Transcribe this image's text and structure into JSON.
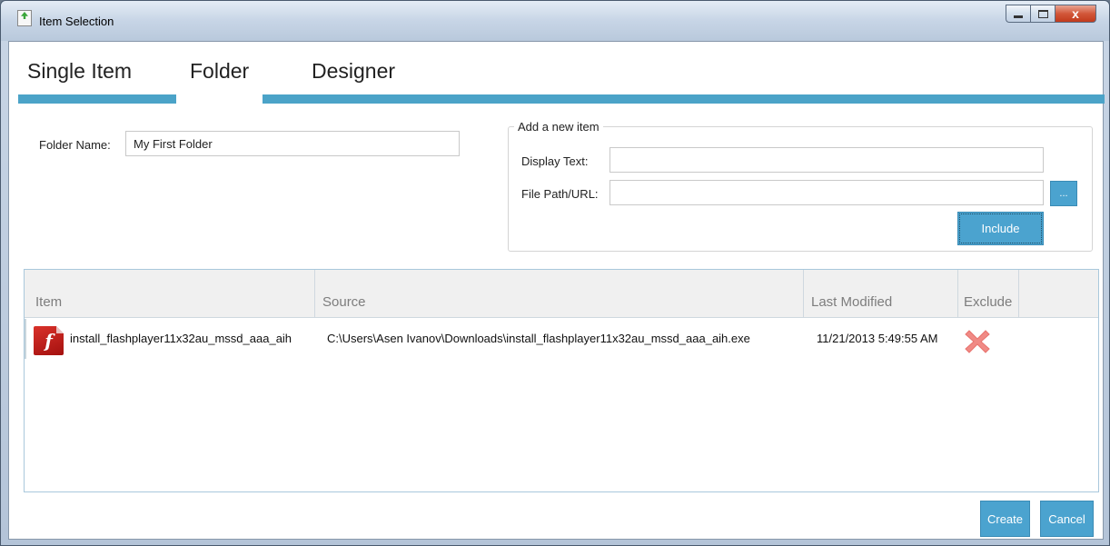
{
  "window": {
    "title": "Item Selection",
    "minimize_label": "minimize",
    "maximize_label": "maximize",
    "close_glyph": "x"
  },
  "tabs": [
    {
      "label": "Single Item"
    },
    {
      "label": "Folder"
    },
    {
      "label": "Designer"
    }
  ],
  "folder": {
    "name_label": "Folder Name:",
    "name_value": "My First Folder"
  },
  "add_item": {
    "legend": "Add a new item",
    "display_text_label": "Display Text:",
    "display_text_value": "",
    "file_path_label": "File Path/URL:",
    "file_path_value": "",
    "browse_label": "...",
    "include_label": "Include"
  },
  "grid": {
    "columns": [
      "Item",
      "Source",
      "Last Modified",
      "Exclude"
    ],
    "rows": [
      {
        "icon": "flash-installer-icon",
        "item": "install_flashplayer11x32au_mssd_aaa_aih",
        "source": "C:\\Users\\Asen Ivanov\\Downloads\\install_flashplayer11x32au_mssd_aaa_aih.exe",
        "last_modified": "11/21/2013 5:49:55 AM",
        "exclude_icon": "red-x-icon"
      }
    ]
  },
  "footer": {
    "create_label": "Create",
    "cancel_label": "Cancel"
  },
  "colors": {
    "accent": "#4ba3c8",
    "button": "#4ba3cf",
    "exclude": "#f08a85"
  }
}
